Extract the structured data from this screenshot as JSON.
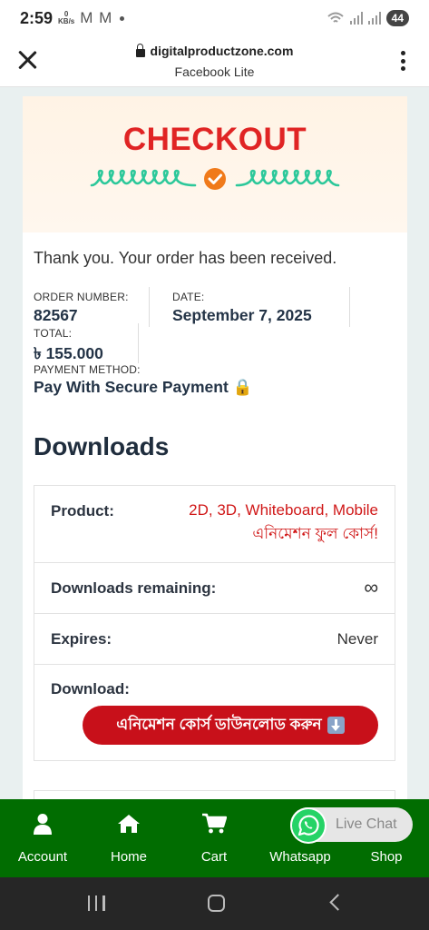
{
  "status_bar": {
    "time": "2:59",
    "net_speed_value": "0",
    "net_speed_unit": "KB/s",
    "notif_icons": "M M",
    "battery": "44"
  },
  "browser": {
    "domain": "digitalproductzone.com",
    "app_name": "Facebook Lite"
  },
  "hero": {
    "title": "CHECKOUT",
    "title_color": "#e02424",
    "squiggle_color": "#2cc89a",
    "check_color": "#f07a1a"
  },
  "order": {
    "thanks_message": "Thank you. Your order has been received.",
    "order_number_label": "ORDER NUMBER:",
    "order_number": "82567",
    "date_label": "DATE:",
    "date": "September 7, 2025",
    "total_label": "TOTAL:",
    "total": "৳ 155.000",
    "payment_label": "PAYMENT METHOD:",
    "payment_method": "Pay With Secure Payment 🔒"
  },
  "downloads": {
    "heading": "Downloads",
    "product_label": "Product:",
    "product_line1": "2D, 3D, Whiteboard, Mobile",
    "product_line2": "এনিমেশন ফুল কোর্স!",
    "remaining_label": "Downloads remaining:",
    "remaining_value": "∞",
    "expires_label": "Expires:",
    "expires_value": "Never",
    "download_label": "Download:",
    "download_button": "এনিমেশন কোর্স ডাউনলোড করুন"
  },
  "bottom_nav": {
    "color": "#016d01",
    "items": [
      {
        "label": "Account",
        "icon": "user-icon"
      },
      {
        "label": "Home",
        "icon": "home-icon"
      },
      {
        "label": "Cart",
        "icon": "cart-icon"
      },
      {
        "label": "Whatsapp",
        "icon": "whatsapp-icon"
      },
      {
        "label": "Shop",
        "icon": "shop-icon"
      }
    ]
  },
  "live_chat": {
    "label": "Live Chat"
  }
}
